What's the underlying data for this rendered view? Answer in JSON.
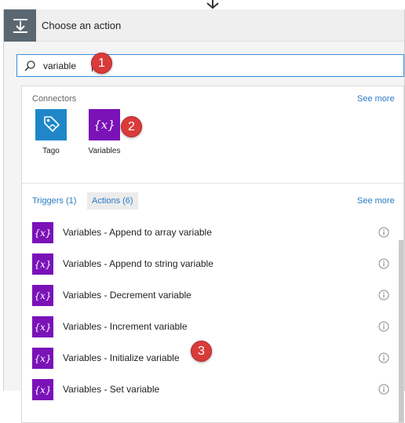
{
  "header": {
    "title": "Choose an action"
  },
  "search": {
    "value": "variable"
  },
  "connectors": {
    "section_label": "Connectors",
    "see_more": "See more",
    "items": [
      {
        "label": "Tago",
        "icon": "tago-icon",
        "color": "#1f87c8"
      },
      {
        "label": "Variables",
        "icon": "variables-icon",
        "glyph": "{x}",
        "color": "#7a12b8"
      }
    ]
  },
  "tabs": [
    {
      "label": "Triggers (1)",
      "selected": false
    },
    {
      "label": "Actions (6)",
      "selected": true
    }
  ],
  "actions_see_more": "See more",
  "actions": [
    {
      "label": "Variables - Append to array variable",
      "glyph": "{x}"
    },
    {
      "label": "Variables - Append to string variable",
      "glyph": "{x}"
    },
    {
      "label": "Variables - Decrement variable",
      "glyph": "{x}"
    },
    {
      "label": "Variables - Increment variable",
      "glyph": "{x}"
    },
    {
      "label": "Variables - Initialize variable",
      "glyph": "{x}"
    },
    {
      "label": "Variables - Set variable",
      "glyph": "{x}"
    }
  ],
  "callouts": [
    "1",
    "2",
    "3"
  ],
  "colors": {
    "accent": "#3a8fd8",
    "variables": "#7a12b8",
    "tago": "#1f87c8",
    "callout": "#d93a3a"
  }
}
